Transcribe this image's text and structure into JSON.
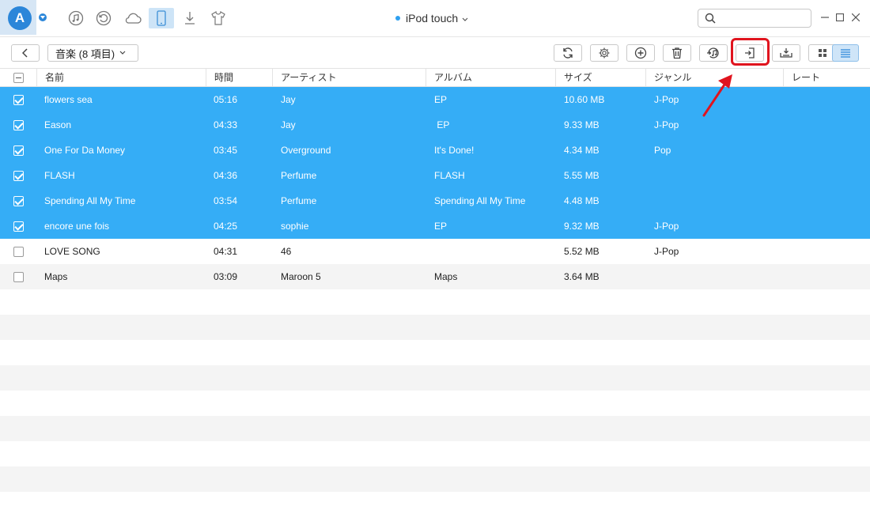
{
  "app": {
    "logo_letter": "A",
    "accent": "#2b86d9"
  },
  "top_icons": [
    "music-icon",
    "history-icon",
    "cloud-icon",
    "device-icon",
    "download-icon",
    "shirt-icon"
  ],
  "device": {
    "name": "iPod touch"
  },
  "search": {
    "placeholder": ""
  },
  "toolbar": {
    "breadcrumb": "音楽 (8 項目)",
    "buttons": [
      "refresh",
      "settings",
      "add",
      "delete",
      "to-itunes",
      "to-computer",
      "to-device",
      "grid-view",
      "list-view"
    ],
    "highlighted_button": "to-computer"
  },
  "table": {
    "columns": [
      "名前",
      "時間",
      "アーティスト",
      "アルバム",
      "サイズ",
      "ジャンル",
      "レート"
    ],
    "rows": [
      {
        "selected": true,
        "name": "flowers sea",
        "time": "05:16",
        "artist": "Jay",
        "album": "EP",
        "size": "10.60 MB",
        "genre": "J-Pop"
      },
      {
        "selected": true,
        "name": "Eason",
        "time": "04:33",
        "artist": "Jay",
        "album": " EP",
        "size": "9.33 MB",
        "genre": "J-Pop"
      },
      {
        "selected": true,
        "name": "One For Da Money",
        "time": "03:45",
        "artist": "Overground",
        "album": "It's Done!",
        "size": "4.34 MB",
        "genre": "Pop"
      },
      {
        "selected": true,
        "name": "FLASH",
        "time": "04:36",
        "artist": "Perfume",
        "album": "FLASH",
        "size": "5.55 MB",
        "genre": ""
      },
      {
        "selected": true,
        "name": "Spending All My Time",
        "time": "03:54",
        "artist": "Perfume",
        "album": "Spending All My Time",
        "size": "4.48 MB",
        "genre": ""
      },
      {
        "selected": true,
        "name": "encore une fois",
        "time": "04:25",
        "artist": "sophie",
        "album": "EP",
        "size": "9.32 MB",
        "genre": "J-Pop"
      },
      {
        "selected": false,
        "name": "LOVE SONG",
        "time": "04:31",
        "artist": "46",
        "album": "",
        "size": "5.52 MB",
        "genre": "J-Pop"
      },
      {
        "selected": false,
        "name": "Maps",
        "time": "03:09",
        "artist": "Maroon 5",
        "album": "Maps",
        "size": "3.64 MB",
        "genre": ""
      }
    ]
  },
  "colors": {
    "selection": "#35adf6",
    "highlight_box": "#e0141e",
    "arrow": "#e0141e"
  }
}
